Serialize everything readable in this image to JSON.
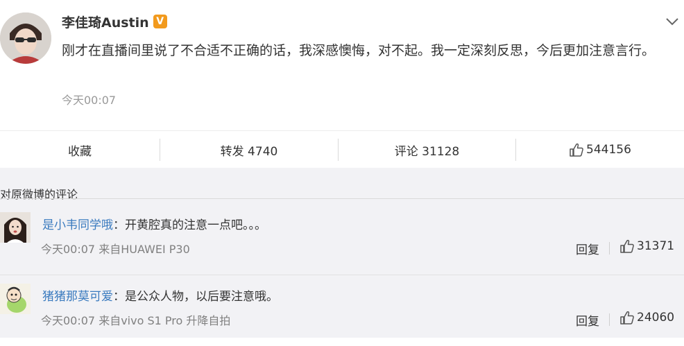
{
  "post": {
    "author": "李佳琦Austin",
    "vip_badge": "V",
    "text": "刚才在直播间里说了不合适不正确的话，我深感懊悔，对不起。我一定深刻反思，今后更加注意言行。",
    "time": "今天00:07"
  },
  "actions": {
    "favorite": "收藏",
    "repost": "转发 4740",
    "comment": "评论 31128",
    "like": "544156"
  },
  "comments": {
    "header": "对原微博的评论",
    "items": [
      {
        "user": "是小韦同学哦",
        "sep": "：",
        "text": "开黄腔真的注意一点吧。。。",
        "meta": "今天00:07 来自HUAWEI P30",
        "reply": "回复",
        "likes": "31371"
      },
      {
        "user": "猪猪那莫可爱",
        "sep": "：",
        "text": "是公众人物，以后要注意哦。",
        "meta": "今天00:07 来自vivo S1 Pro 升降自拍",
        "reply": "回复",
        "likes": "24060"
      }
    ]
  },
  "colors": {
    "username_link": "#3b7bbf",
    "vip_badge": "#f29a1d",
    "comments_bg": "#f2f2f5"
  }
}
